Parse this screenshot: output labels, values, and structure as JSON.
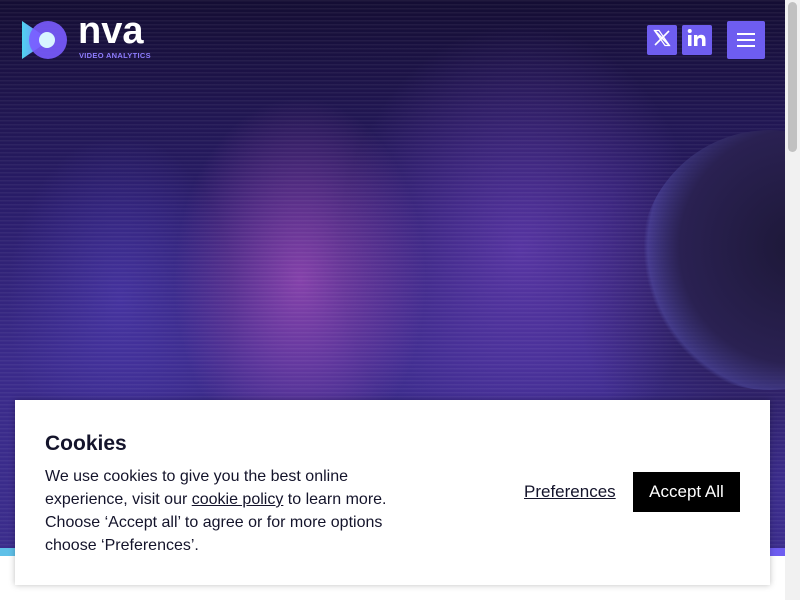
{
  "header": {
    "logo": {
      "word": "nva",
      "subtitle": "VIDEO ANALYTICS"
    },
    "social": [
      {
        "name": "x-icon"
      },
      {
        "name": "linkedin-icon"
      }
    ]
  },
  "cookie_banner": {
    "title": "Cookies",
    "text_before_link": "We use cookies to give you the best online experience, visit our ",
    "link_text": "cookie policy",
    "text_after_link": " to learn more. Choose ‘Accept all’ to agree or for more options choose ‘Preferences’.",
    "preferences_label": "Preferences",
    "accept_label": "Accept All"
  },
  "colors": {
    "accent": "#6e5df0",
    "brand_blue": "#5fc0e8",
    "dark_text": "#14142b"
  }
}
